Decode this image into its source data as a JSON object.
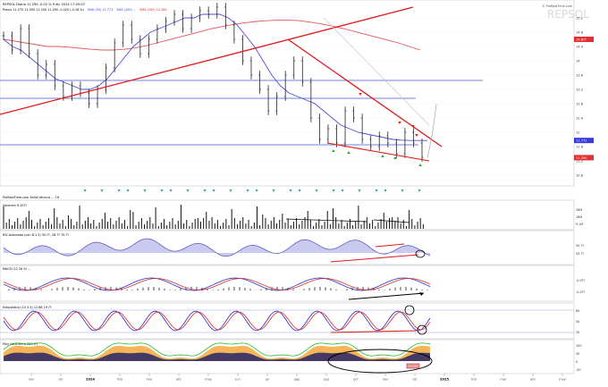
{
  "header": {
    "line1": "REPSOL Diario 11.290 -0.02 % 9 dic 2024 17:05:07",
    "line2_parts": [
      {
        "text": "Precio 11.275 11.300 11.200 11.290 -0.020 (-0.18 %)",
        "color": "#000000"
      },
      {
        "text": "SMA (50) 11.771",
        "color": "#3a3adc"
      },
      {
        "text": "SMA (100) ...",
        "color": "#3a3adc"
      },
      {
        "text": "SMA (200) 12.282",
        "color": "#e02020"
      }
    ],
    "watermark": "REPSOL",
    "site": "© ProRealTime.com"
  },
  "colors": {
    "price": "#222222",
    "sma_fast": "#4f4fd6",
    "sma_slow": "#e05a5a",
    "trendline": "#e01818",
    "horizontal": "#6a86d8",
    "volume": "#111111",
    "rsi_fill": "#8a8ae0",
    "macd_hist": "#444444",
    "stoch_k": "#2828c8",
    "stoch_d": "#e02828",
    "area_fill": "#f2a93b",
    "area_dark": "#252566",
    "green_line": "#22bb22"
  },
  "chart_data": {
    "type": "line",
    "title": "REPSOL Diario",
    "x_tick_labels": [
      "nov",
      "dic",
      "2024",
      "feb",
      "mar",
      "abr",
      "may",
      "jun",
      "jul",
      "ago",
      "sep",
      "oct",
      "nov",
      "dic",
      "2025",
      "feb",
      "mar",
      "abr",
      "may"
    ],
    "price_axis": [
      "15.2",
      "14.8",
      "14.4",
      "14",
      "13.6",
      "13.2",
      "12.8",
      "12.4",
      "12",
      "11.6",
      "11.2",
      "10.8"
    ],
    "price_labels": [
      {
        "value": "14.6??",
        "color": "#e03030"
      },
      {
        "value": "11.771",
        "color": "#3a3adc"
      },
      {
        "value": "11.290",
        "color": "#e03030"
      }
    ],
    "ylim": [
      10.6,
      15.5
    ],
    "series": [
      {
        "values": [
          14.7,
          14.3,
          14.9,
          14.2,
          13.6,
          13.9,
          13.3,
          13.0,
          13.3,
          13.1,
          12.8,
          13.2,
          13.8,
          14.5,
          15.0,
          14.6,
          14.2,
          14.6,
          14.9,
          15.1,
          15.3,
          14.9,
          15.2,
          15.4,
          15.3,
          15.5,
          15.0,
          14.6,
          14.0,
          13.6,
          13.2,
          12.6,
          13.0,
          13.6,
          14.0,
          13.4,
          12.4,
          11.8,
          12.1,
          11.7,
          12.6,
          12.4,
          11.8,
          11.6,
          11.9,
          11.7,
          11.4,
          12.0,
          11.7,
          11.3
        ]
      }
    ],
    "sma_fast": [
      14.6,
      14.4,
      14.3,
      14.1,
      13.9,
      13.7,
      13.5,
      13.4,
      13.3,
      13.2,
      13.2,
      13.3,
      13.5,
      13.8,
      14.1,
      14.4,
      14.6,
      14.8,
      14.9,
      15.0,
      15.1,
      15.2,
      15.2,
      15.3,
      15.3,
      15.3,
      15.2,
      15.0,
      14.7,
      14.4,
      14.0,
      13.6,
      13.3,
      13.1,
      13.0,
      12.9,
      12.8,
      12.6,
      12.4,
      12.2,
      12.1,
      12.0,
      11.95,
      11.9,
      11.85,
      11.8,
      11.78,
      11.77,
      11.77,
      11.77
    ],
    "sma_slow": [
      14.6,
      14.55,
      14.5,
      14.45,
      14.4,
      14.4,
      14.38,
      14.35,
      14.32,
      14.3,
      14.3,
      14.32,
      14.36,
      14.42,
      14.5,
      14.58,
      14.66,
      14.74,
      14.82,
      14.9,
      14.96,
      15.02,
      15.06,
      15.1,
      15.12,
      15.14,
      15.14,
      15.12,
      15.08,
      15.03,
      14.97,
      14.9,
      14.82,
      14.74,
      14.66,
      14.58,
      14.5,
      14.4,
      14.3
    ],
    "horizontal_levels": [
      13.45,
      12.95,
      11.65
    ],
    "volume_axis": [
      "26M",
      "18M",
      "9.1M"
    ],
    "volume_label": "Volumen 9.10??",
    "rsi_label": "RSI Avanzado (con B.1.3)  35.??, 28.??  70.??",
    "rsi_ticks": [
      "50.??",
      "33.??"
    ],
    "macd_label": "MACD (12 26 9) ...",
    "macd_ticks": [
      "-0.0??",
      "-0.0??"
    ],
    "stoch_label": "Estocástico (14 3 3) 12.88  19.??",
    "stoch_ticks": [
      "80",
      "50",
      "20"
    ],
    "area_label": "Muy Volumen a 250 (?)",
    "area_ticks": [
      "100",
      "50",
      "0",
      "-50"
    ]
  },
  "drawings_label": "ProRealTime.com  Señal técnica ... 1H"
}
